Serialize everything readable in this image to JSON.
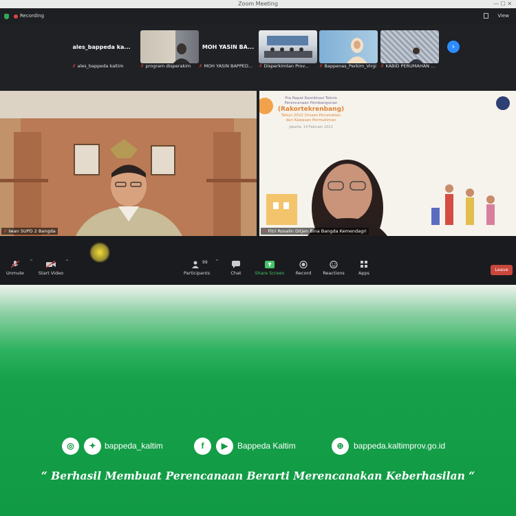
{
  "window": {
    "title": "Zoom Meeting"
  },
  "topbar": {
    "recording_label": "Recording",
    "view_label": "View"
  },
  "thumbnails": [
    {
      "display": "ales_bappeda  ka...",
      "caption": "ales_bappeda kaltim"
    },
    {
      "display": "",
      "caption": "program disperakim"
    },
    {
      "display": "MOH YASIN BA...",
      "caption": "MOH YASIN BAPPED..."
    },
    {
      "display": "",
      "caption": "Disperkimtan Prov..."
    },
    {
      "display": "",
      "caption": "Bappenas_Perkim_Virgi"
    },
    {
      "display": "",
      "caption": "KABID PERUMAHAN ..."
    }
  ],
  "main_videos": {
    "left": {
      "name": "Iwan SUPD 2 Bangda"
    },
    "right": {
      "name": "Fitri Rosalin Ditjen Bina Bangda Kemendagri",
      "slide": {
        "line1": "Pra Rapat Koordinasi Teknis",
        "line2": "Perencanaan Pembangunan",
        "line3": "(Rakortekrenbang)",
        "line4": "Tahun 2022 Urusan Perumahan",
        "line5": "dan Kawasan Permukiman",
        "date": "Jakarta, 14 Februari 2022"
      }
    }
  },
  "toolbar": {
    "unmute": "Unmute",
    "start_video": "Start Video",
    "participants": "Participants",
    "participants_count": "99",
    "chat": "Chat",
    "share_screen": "Share Screen",
    "record": "Record",
    "reactions": "Reactions",
    "apps": "Apps",
    "leave": "Leave"
  },
  "banner": {
    "instagram": "bappeda_kaltim",
    "youtube": "Bappeda Kaltim",
    "website": "bappeda.kaltimprov.go.id",
    "tagline": "“ Berhasil  Membuat Perencanaan Berarti Merencanakan Keberhasilan “"
  },
  "colors": {
    "zoom_blue": "#2d8cff",
    "share_green": "#45c46a",
    "leave_red": "#c9473d",
    "brand_green": "#119a44"
  }
}
